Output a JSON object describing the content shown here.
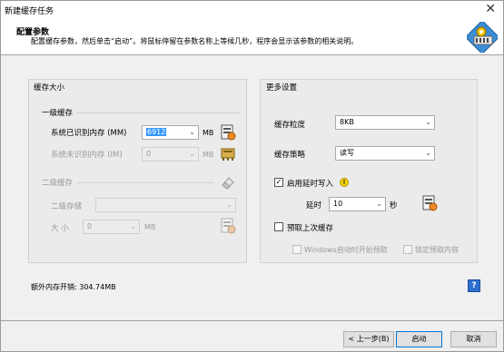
{
  "window": {
    "title": "新建缓存任务",
    "close_glyph": "✕"
  },
  "header": {
    "title": "配置参数",
    "description": "配置缓存参数，然后单击“启动”。将鼠标停留在参数名称上等候几秒，程序会显示该参数的相关说明。",
    "icon": "wizard-gear-icon"
  },
  "left": {
    "title": "缓存大小",
    "level1": {
      "title": "一级缓存",
      "recognized": {
        "label": "系统已识别内存 (MM)",
        "value": "6912",
        "unit": "MB",
        "icon": "memory-chip-icon"
      },
      "unrecognized": {
        "label": "系统未识别内存 (IM)",
        "value": "0",
        "unit": "MB",
        "icon": "memory-chip-icon"
      }
    },
    "level2": {
      "title": "二级缓存",
      "icon": "eraser-icon",
      "storage": {
        "label": "二级存储",
        "value": ""
      },
      "size": {
        "label": "大 小",
        "value": "0",
        "unit": "MB",
        "icon": "memory-chip-icon"
      }
    }
  },
  "right": {
    "title": "更多设置",
    "granularity": {
      "label": "缓存粒度",
      "value": "8KB"
    },
    "strategy": {
      "label": "缓存策略",
      "value": "读写"
    },
    "delay_write": {
      "label": "启用延时写入",
      "checked": true,
      "check_glyph": "✓",
      "warning_glyph": "!"
    },
    "delay": {
      "label": "延时",
      "value": "10",
      "unit": "秒",
      "icon": "memory-chip-icon"
    },
    "prefetch": {
      "label": "预取上次缓存",
      "checked": false
    },
    "prefetch_on_start": {
      "label": "Windows启动时开始预取",
      "checked": false
    },
    "lock_prefetch": {
      "label": "锁定预取内容",
      "checked": false
    }
  },
  "footer": {
    "extra_memory": "额外内存开销: 304.74MB",
    "help": "?",
    "buttons": {
      "prev": "< 上一步(B)",
      "start": "启动",
      "cancel": "取消"
    }
  }
}
